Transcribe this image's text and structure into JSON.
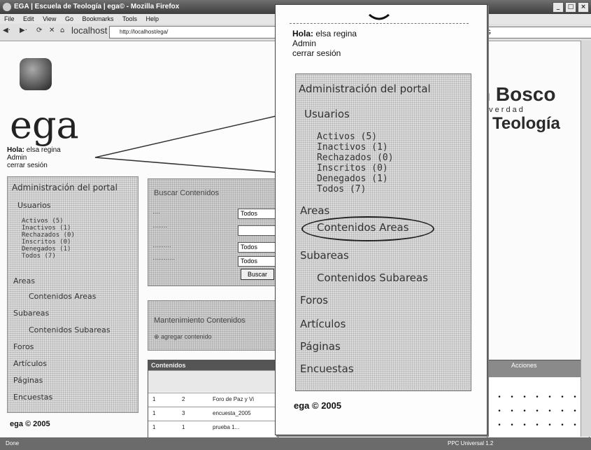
{
  "browser": {
    "title": "EGA | Escuela de Teología | ega© - Mozilla Firefox",
    "menu": [
      "File",
      "Edit",
      "View",
      "Go",
      "Bookmarks",
      "Tools",
      "Help"
    ],
    "address": "localhost",
    "url": "http://localhost/ega/",
    "status_left": "Done",
    "status_right": "PPC Universal 1.2"
  },
  "brand": {
    "line1": "n Bosco",
    "line2": "a verdad",
    "line3": "e Teología",
    "logo_text": "ega"
  },
  "user": {
    "greeting_label": "Hola:",
    "name": "elsa regina",
    "role": "Admin",
    "logout_prefix": "cerrar",
    "logout_suffix": "sesión",
    "logout": "cerrar sesión"
  },
  "sidebar": {
    "heading": "Administración del portal",
    "usuarios": "Usuarios",
    "users": [
      "Activos (5)",
      "Inactivos (1)",
      "Rechazados (0)",
      "Inscritos (0)",
      "Denegados (1)",
      "Todos (7)"
    ],
    "areas": "Areas",
    "contenidos_areas": "Contenidos Areas",
    "subareas": "Subareas",
    "contenidos_subareas": "Contenidos Subareas",
    "foros": "Foros",
    "articulos": "Artículos",
    "paginas": "Páginas",
    "encuestas": "Encuestas"
  },
  "footer": "ega © 2005",
  "search": {
    "heading": "Buscar Contenidos",
    "select_value": "Todos",
    "button": "Buscar"
  },
  "maint": {
    "heading": "Mantenimiento Contenidos",
    "add": "agregar contenido"
  },
  "table": {
    "heading": "Contenidos",
    "rows": [
      {
        "a": "1",
        "b": "2",
        "c": "Foro de Paz y Vi"
      },
      {
        "a": "1",
        "b": "3",
        "c": "encuesta_2005"
      },
      {
        "a": "1",
        "b": "1",
        "c": "prueba 1..."
      }
    ]
  },
  "grid": {
    "heading": "Acciones"
  },
  "zoom": {
    "footer": "ega © 2005"
  }
}
